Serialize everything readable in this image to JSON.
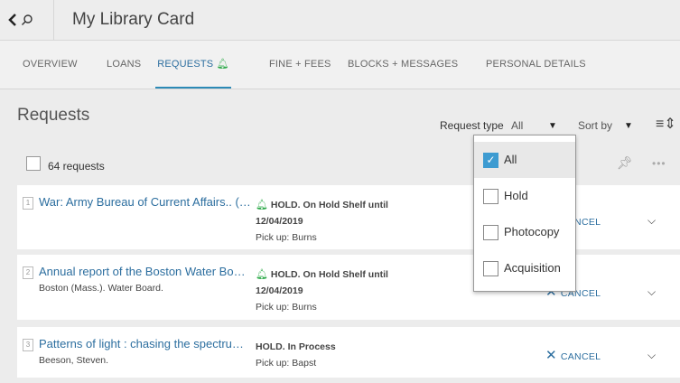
{
  "header": {
    "title": "My Library Card"
  },
  "tabs": [
    {
      "label": "OVERVIEW"
    },
    {
      "label": "LOANS"
    },
    {
      "label": "REQUESTS"
    },
    {
      "label": "FINE + FEES"
    },
    {
      "label": "BLOCKS + MESSAGES"
    },
    {
      "label": "PERSONAL DETAILS"
    }
  ],
  "requests": {
    "heading": "Requests",
    "count_label": "64 requests",
    "filter_label": "Request type",
    "filter_value": "All",
    "sort_label": "Sort by"
  },
  "dropdown": {
    "options": [
      {
        "label": "All",
        "checked": true
      },
      {
        "label": "Hold",
        "checked": false
      },
      {
        "label": "Photocopy",
        "checked": false
      },
      {
        "label": "Acquisition",
        "checked": false
      }
    ]
  },
  "items": [
    {
      "index": "1",
      "title": "War: Army Bureau of Current Affairs.. (…",
      "author": "",
      "status_bold": "HOLD. On Hold Shelf until",
      "status_date": "12/04/2019",
      "pickup": "Pick up: Burns",
      "cancel": "CANCEL"
    },
    {
      "index": "2",
      "title": "Annual report of the Boston Water Bo…",
      "author": "Boston (Mass.). Water Board.",
      "status_bold": "HOLD. On Hold Shelf until",
      "status_date": "12/04/2019",
      "pickup": "Pick up: Burns",
      "cancel": "CANCEL"
    },
    {
      "index": "3",
      "title": "Patterns of light : chasing the spectru…",
      "author": "Beeson, Steven.",
      "status_bold": "HOLD. In Process",
      "status_date": "",
      "pickup": "Pick up: Bapst",
      "cancel": "CANCEL"
    }
  ],
  "icons": {
    "back": "chevron-left-icon",
    "search": "search-icon",
    "bell": "bell-icon",
    "pin": "pin-icon",
    "more": "more-icon",
    "sort": "sort-icon"
  },
  "colors": {
    "accent": "#2c6e9f",
    "bell": "#2eaa4a",
    "checkbox": "#3d9bd1"
  }
}
